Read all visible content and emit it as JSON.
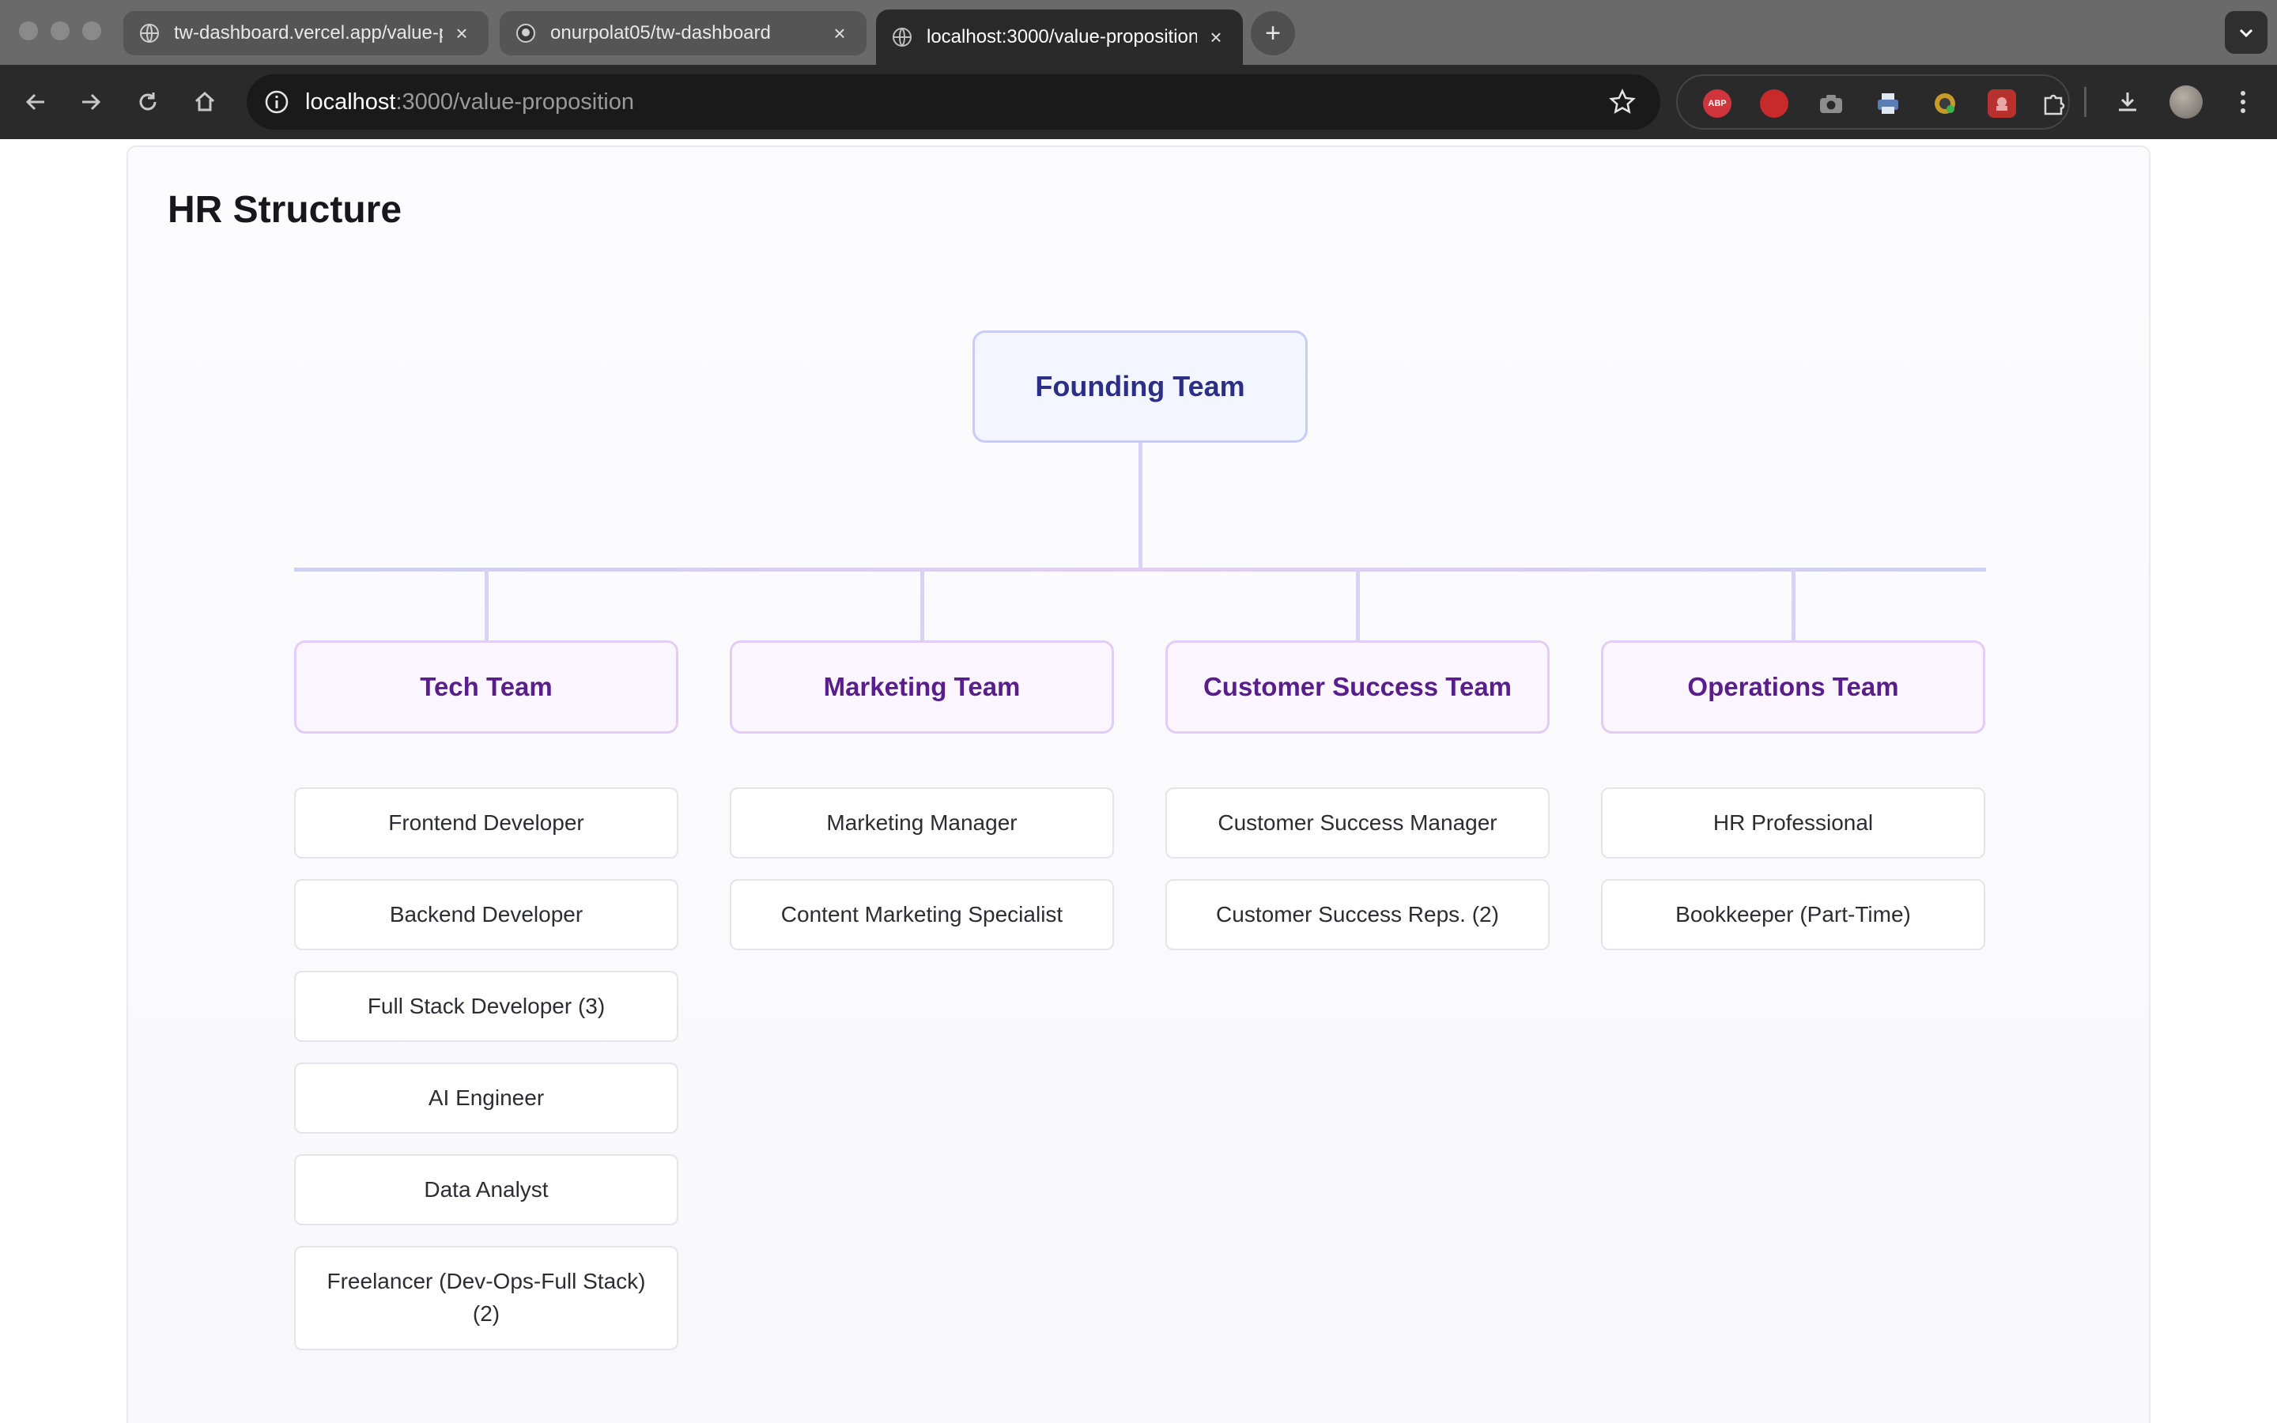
{
  "browser": {
    "tabs": [
      {
        "title": "tw-dashboard.vercel.app/value-proposition",
        "favicon": "globe-icon",
        "active": false
      },
      {
        "title": "onurpolat05/tw-dashboard",
        "favicon": "github-icon",
        "active": false
      },
      {
        "title": "localhost:3000/value-proposition",
        "favicon": "globe-icon",
        "active": true
      }
    ],
    "new_tab_symbol": "+",
    "url": {
      "host": "localhost",
      "rest": ":3000/value-proposition"
    },
    "extensions": [
      {
        "name": "adblock-plus-icon",
        "label": "ABP",
        "color": "#d0343c"
      },
      {
        "name": "stop-hand-icon",
        "label": "✋",
        "color": "#c62a2a"
      },
      {
        "name": "camera-icon",
        "label": "",
        "color": "#8d8d8d"
      },
      {
        "name": "printer-icon",
        "label": "",
        "color": "#5b7fb4"
      },
      {
        "name": "color-picker-icon",
        "label": "",
        "color": "#c79a2b"
      },
      {
        "name": "red-extension-icon",
        "label": "",
        "color": "#b8312f"
      }
    ]
  },
  "page": {
    "title": "HR Structure"
  },
  "org_chart": {
    "root": "Founding Team",
    "teams": [
      {
        "name": "Tech Team",
        "roles": [
          "Frontend Developer",
          "Backend Developer",
          "Full Stack Developer (3)",
          "AI Engineer",
          "Data Analyst",
          "Freelancer (Dev-Ops-Full Stack) (2)"
        ]
      },
      {
        "name": "Marketing Team",
        "roles": [
          "Marketing Manager",
          "Content Marketing Specialist"
        ]
      },
      {
        "name": "Customer Success Team",
        "roles": [
          "Customer Success Manager",
          "Customer Success Reps. (2)"
        ]
      },
      {
        "name": "Operations Team",
        "roles": [
          "HR Professional",
          "Bookkeeper (Part-Time)"
        ]
      }
    ]
  }
}
